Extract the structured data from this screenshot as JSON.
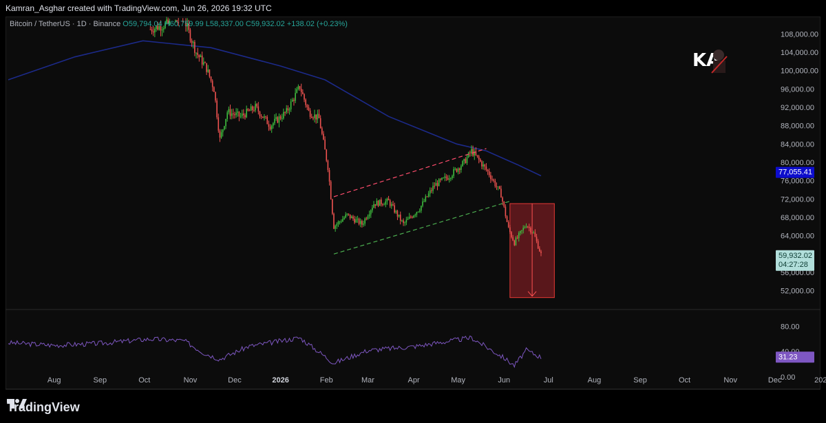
{
  "header": {
    "credit": "Kamran_Asghar created with TradingView.com, Jun 26, 2026 19:32 UTC"
  },
  "legend": {
    "symbol": "Bitcoin / TetherUS · 1D · Binance",
    "open": "O59,794.04",
    "high": "H60,759.99",
    "low": "L58,337.00",
    "close": "C59,932.02",
    "change": "+138.02 (+0.23%)"
  },
  "price_axis": {
    "ticks": [
      "108,000.00",
      "104,000.00",
      "100,000.00",
      "96,000.00",
      "92,000.00",
      "88,000.00",
      "84,000.00",
      "80,000.00",
      "76,000.00",
      "72,000.00",
      "68,000.00",
      "64,000.00",
      "60,000.00",
      "56,000.00",
      "52,000.00"
    ],
    "ma_label": "77,055.41",
    "price_label": "59,932.02",
    "countdown": "04:27:28"
  },
  "rsi_axis": {
    "ticks": [
      "80.00",
      "40.00",
      "0.00"
    ],
    "value_label": "31.23"
  },
  "time_axis": {
    "labels": [
      "Aug",
      "Sep",
      "Oct",
      "Nov",
      "Dec",
      "2026",
      "Feb",
      "Mar",
      "Apr",
      "May",
      "Jun",
      "Jul",
      "Aug",
      "Sep",
      "Oct",
      "Nov",
      "Dec",
      "202"
    ]
  },
  "colors": {
    "up": "#26a69a",
    "up_bright": "#4caf50",
    "down": "#ef5350",
    "ma": "#1a237e",
    "rsi": "#7e57c2",
    "ma_badge": "#0d0dcc",
    "price_badge": "#b2dfdb",
    "rsi_badge": "#7e57c2",
    "projection": "#7a1c22"
  },
  "branding": {
    "footer_text": "TradingView",
    "logo_icon": "tradingview-logo-icon",
    "watermark_icon": "ka-avatar-watermark-icon"
  },
  "chart_data": {
    "type": "candlestick",
    "symbol": "Bitcoin / TetherUS",
    "interval": "1D",
    "exchange": "Binance",
    "last_bar": {
      "open": 59794.04,
      "high": 60759.99,
      "low": 58337.0,
      "close": 59932.02,
      "change": 138.02,
      "change_pct": 0.23
    },
    "y_range": [
      50000,
      110000
    ],
    "x_months": [
      "Aug",
      "Sep",
      "Oct",
      "Nov",
      "Dec",
      "2026",
      "Feb",
      "Mar",
      "Apr",
      "May",
      "Jun",
      "Jul",
      "Aug",
      "Sep",
      "Oct",
      "Nov",
      "Dec"
    ],
    "price_path": [
      {
        "x": "2025-10-05",
        "y": 109000
      },
      {
        "x": "2025-10-20",
        "y": 110500
      },
      {
        "x": "2025-10-28",
        "y": 111000
      },
      {
        "x": "2025-11-05",
        "y": 104000
      },
      {
        "x": "2025-11-12",
        "y": 100500
      },
      {
        "x": "2025-11-17",
        "y": 96000
      },
      {
        "x": "2025-11-21",
        "y": 85000
      },
      {
        "x": "2025-11-26",
        "y": 91000
      },
      {
        "x": "2025-12-05",
        "y": 90000
      },
      {
        "x": "2025-12-15",
        "y": 92000
      },
      {
        "x": "2025-12-25",
        "y": 88000
      },
      {
        "x": "2026-01-05",
        "y": 91000
      },
      {
        "x": "2026-01-14",
        "y": 96500
      },
      {
        "x": "2026-01-20",
        "y": 91000
      },
      {
        "x": "2026-01-27",
        "y": 89500
      },
      {
        "x": "2026-02-02",
        "y": 79000
      },
      {
        "x": "2026-02-06",
        "y": 66000
      },
      {
        "x": "2026-02-15",
        "y": 68500
      },
      {
        "x": "2026-02-25",
        "y": 66500
      },
      {
        "x": "2026-03-05",
        "y": 71000
      },
      {
        "x": "2026-03-15",
        "y": 71500
      },
      {
        "x": "2026-03-25",
        "y": 66500
      },
      {
        "x": "2026-04-05",
        "y": 70000
      },
      {
        "x": "2026-04-15",
        "y": 75000
      },
      {
        "x": "2026-04-25",
        "y": 77000
      },
      {
        "x": "2026-05-05",
        "y": 80000
      },
      {
        "x": "2026-05-10",
        "y": 82500
      },
      {
        "x": "2026-05-15",
        "y": 80500
      },
      {
        "x": "2026-05-22",
        "y": 77500
      },
      {
        "x": "2026-05-30",
        "y": 73000
      },
      {
        "x": "2026-06-04",
        "y": 65500
      },
      {
        "x": "2026-06-08",
        "y": 62500
      },
      {
        "x": "2026-06-16",
        "y": 66500
      },
      {
        "x": "2026-06-21",
        "y": 64500
      },
      {
        "x": "2026-06-26",
        "y": 59932
      }
    ],
    "moving_average": [
      {
        "x": "2025-07-01",
        "y": 98000
      },
      {
        "x": "2025-08-15",
        "y": 103000
      },
      {
        "x": "2025-09-30",
        "y": 106500
      },
      {
        "x": "2025-11-15",
        "y": 105000
      },
      {
        "x": "2026-01-01",
        "y": 101000
      },
      {
        "x": "2026-01-31",
        "y": 98000
      },
      {
        "x": "2026-03-15",
        "y": 90000
      },
      {
        "x": "2026-04-30",
        "y": 84000
      },
      {
        "x": "2026-05-20",
        "y": 82500
      },
      {
        "x": "2026-06-10",
        "y": 79500
      },
      {
        "x": "2026-06-26",
        "y": 77055.41
      }
    ],
    "channel_upper": [
      {
        "x": "2026-02-06",
        "y": 72500
      },
      {
        "x": "2026-05-20",
        "y": 83000
      }
    ],
    "channel_lower": [
      {
        "x": "2026-02-06",
        "y": 60000
      },
      {
        "x": "2026-06-05",
        "y": 71500
      }
    ],
    "projection_box": {
      "x_start": "2026-06-05",
      "x_end": "2026-07-05",
      "y_top": 71000,
      "y_bottom": 50500
    },
    "rsi": {
      "y_range": [
        0,
        100
      ],
      "last": 31.23,
      "points": [
        {
          "x": "2025-07-01",
          "y": 54
        },
        {
          "x": "2025-08-01",
          "y": 50
        },
        {
          "x": "2025-09-01",
          "y": 53
        },
        {
          "x": "2025-10-05",
          "y": 60
        },
        {
          "x": "2025-10-28",
          "y": 57
        },
        {
          "x": "2025-11-10",
          "y": 38
        },
        {
          "x": "2025-11-21",
          "y": 28
        },
        {
          "x": "2025-12-10",
          "y": 48
        },
        {
          "x": "2026-01-14",
          "y": 62
        },
        {
          "x": "2026-02-06",
          "y": 22
        },
        {
          "x": "2026-03-01",
          "y": 42
        },
        {
          "x": "2026-04-01",
          "y": 48
        },
        {
          "x": "2026-05-10",
          "y": 62
        },
        {
          "x": "2026-06-01",
          "y": 30
        },
        {
          "x": "2026-06-08",
          "y": 18
        },
        {
          "x": "2026-06-16",
          "y": 42
        },
        {
          "x": "2026-06-26",
          "y": 31.23
        }
      ]
    }
  }
}
